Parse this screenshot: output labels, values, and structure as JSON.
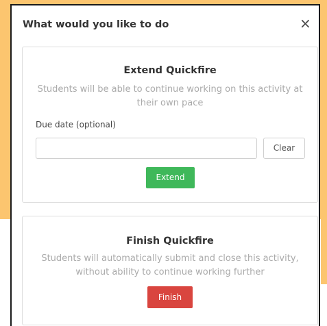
{
  "modal": {
    "title": "What would you like to do",
    "close_label": "×"
  },
  "extend_card": {
    "title": "Extend Quickfire",
    "description": "Students will be able to continue working on this activity at their own pace",
    "due_date_label": "Due date (optional)",
    "due_date_value": "",
    "due_date_placeholder": "",
    "clear_label": "Clear",
    "extend_label": "Extend"
  },
  "finish_card": {
    "title": "Finish Quickfire",
    "description": "Students will automatically submit and close this activity, without ability to continue working further",
    "finish_label": "Finish"
  },
  "colors": {
    "backdrop": "#fcc56f",
    "extend_button": "#3fb85a",
    "finish_button": "#d9453f"
  }
}
